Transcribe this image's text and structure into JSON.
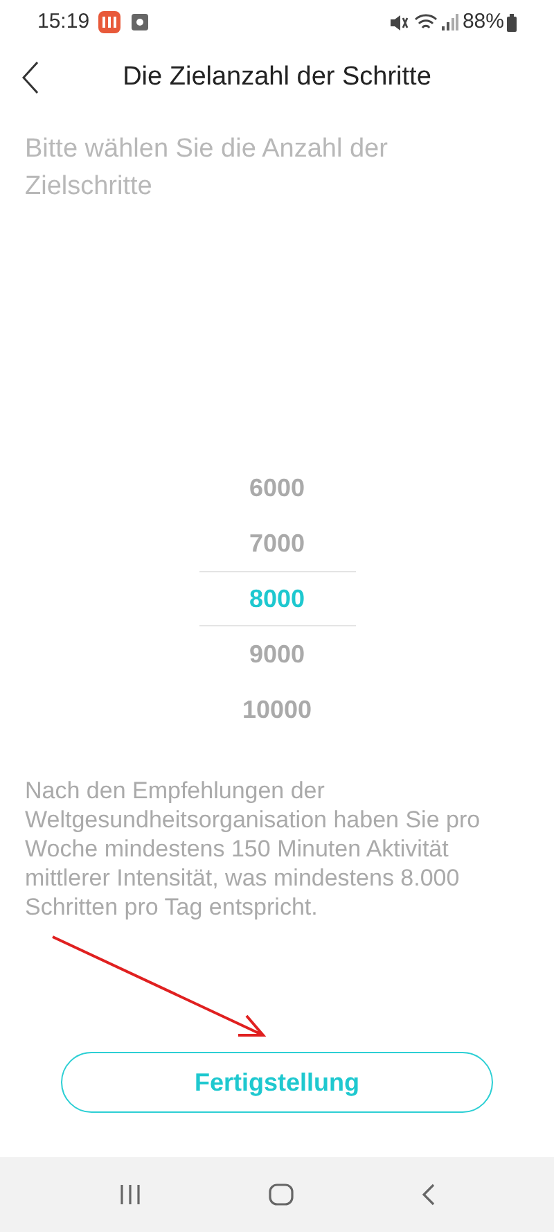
{
  "status_bar": {
    "time": "15:19",
    "battery": "88%"
  },
  "header": {
    "title": "Die Zielanzahl der Schritte"
  },
  "prompt": "Bitte wählen Sie die Anzahl der Zielschritte",
  "picker": {
    "options": [
      {
        "label": "6000",
        "selected": false
      },
      {
        "label": "7000",
        "selected": false
      },
      {
        "label": "8000",
        "selected": true
      },
      {
        "label": "9000",
        "selected": false
      },
      {
        "label": "10000",
        "selected": false
      }
    ]
  },
  "note": "Nach den Empfehlungen der Weltgesundheitsorganisation haben Sie pro Woche mindestens 150 Minuten Aktivität mittlerer Intensität, was mindestens 8.000 Schritten pro Tag entspricht.",
  "button": "Fertigstellung"
}
